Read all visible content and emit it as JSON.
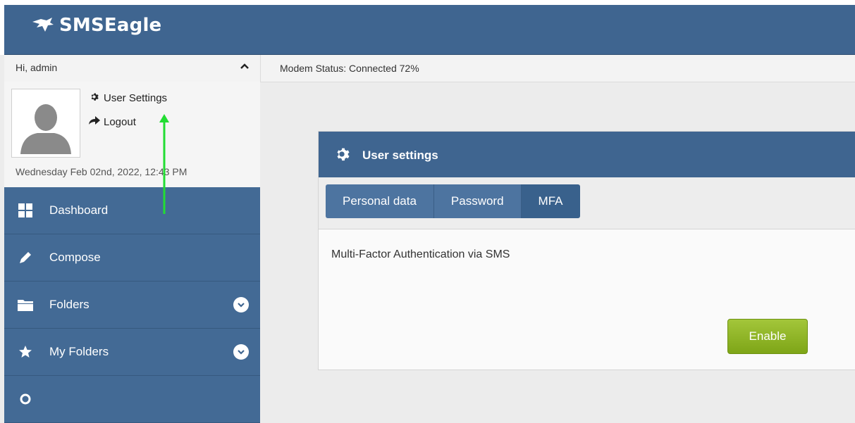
{
  "app": {
    "name": "SMSEagle"
  },
  "sidebar": {
    "greeting": "Hi, admin",
    "collapse_icon": "chevron-up-icon",
    "user_links": [
      {
        "label": "User Settings",
        "icon": "gear-icon"
      },
      {
        "label": "Logout",
        "icon": "share-arrow-icon"
      }
    ],
    "datetime": "Wednesday Feb 02nd, 2022, 12:43 PM",
    "nav": [
      {
        "label": "Dashboard",
        "icon": "grid-icon"
      },
      {
        "label": "Compose",
        "icon": "pencil-icon"
      },
      {
        "label": "Folders",
        "icon": "folder-icon",
        "expandable": true
      },
      {
        "label": "My Folders",
        "icon": "star-icon",
        "expandable": true
      }
    ]
  },
  "status": {
    "text": "Modem Status: Connected 72%"
  },
  "panel": {
    "title": "User settings",
    "tabs": [
      {
        "label": "Personal data",
        "active": false
      },
      {
        "label": "Password",
        "active": false
      },
      {
        "label": "MFA",
        "active": true
      }
    ],
    "content_text": "Multi-Factor Authentication via SMS",
    "enable_label": "Enable"
  },
  "colors": {
    "header": "#3f6590",
    "nav": "#436a95",
    "enable": "#8db326",
    "annotation_arrow": "#22dd33"
  }
}
